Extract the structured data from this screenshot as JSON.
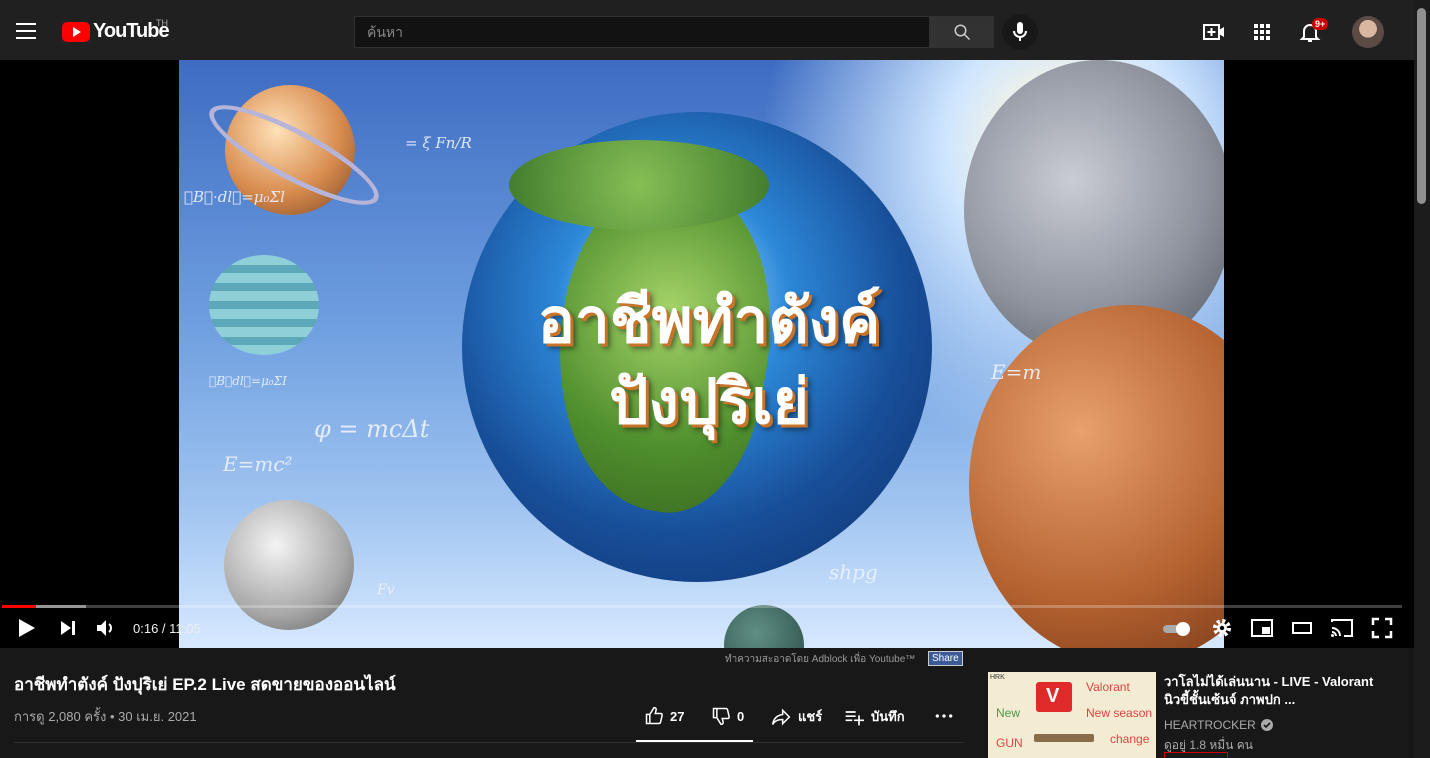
{
  "header": {
    "logo_text": "YouTube",
    "country_code": "TH",
    "search_placeholder": "ค้นหา",
    "notification_count": "9+"
  },
  "player": {
    "title_art_line1": "อาชีพทำตังค์",
    "title_art_line2": "ปังปุริเย่",
    "formulas": [
      "∮B⃗·dl⃗=μ₀Σl",
      "= ξ Fn/R",
      "∮B⃗dl⃗=μ₀ΣI",
      "φ = mcΔt",
      "E=mc²",
      "E=m",
      "Fv",
      "shpg"
    ],
    "current_time": "0:16",
    "duration": "11:05",
    "time_display": "0:16 / 11:05",
    "played_fraction": 0.024,
    "loaded_fraction": 0.06,
    "autoplay_on": true
  },
  "below_player": {
    "adblock_text": "ทำความสะอาดโดย Adblock เพื่อ Youtube™",
    "adblock_share": "Share",
    "video_title": "อาชีพทำตังค์ ปังปุริเย่ EP.2 Live สดขายของออนไลน์",
    "meta": "การดู 2,080 ครั้ง • 30 เม.ย. 2021",
    "actions": {
      "likes": "27",
      "dislikes": "0",
      "share": "แชร์",
      "save": "บันทึก"
    }
  },
  "recommendation": {
    "title": "วาโลไม่ได้เล่นนาน - LIVE - Valorant นิวขี้ชั้นเซ้นจ์ ภาพปก ...",
    "channel": "HEARTROCKER",
    "views": "ดูอยู่ 1.8 หมื่น คน",
    "thumb_texts": {
      "corner": "HRK",
      "t1": "Valorant",
      "t2": "New season",
      "t3": "change",
      "t4": "New",
      "t5": "GUN"
    }
  },
  "colors": {
    "accent": "#ff0000",
    "background": "#181818",
    "topbar": "#202020"
  }
}
